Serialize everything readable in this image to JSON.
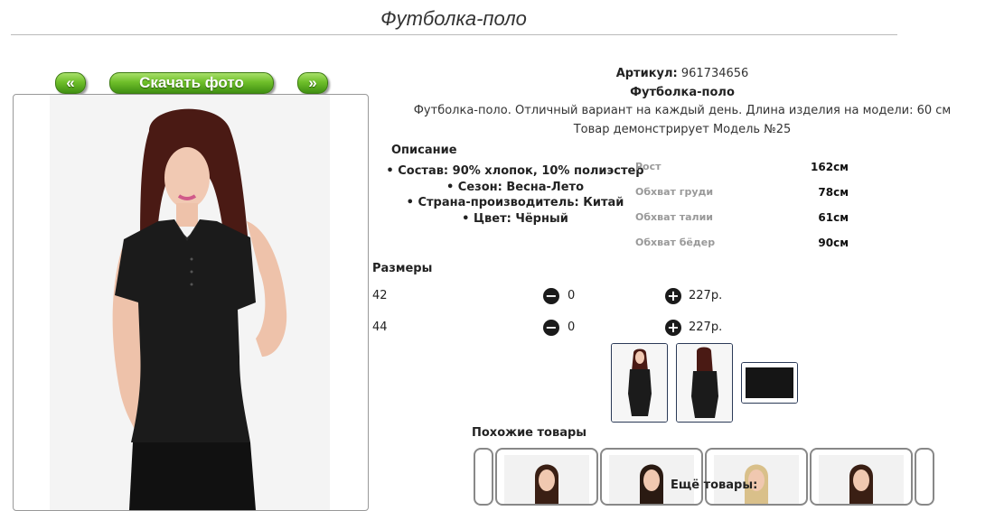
{
  "page": {
    "title": "Футболка-поло"
  },
  "gallery": {
    "prev_label": "«",
    "download_label": "Скачать фото",
    "next_label": "»"
  },
  "product": {
    "articul_label": "Артикул:",
    "articul_value": "961734656",
    "name": "Футболка-поло",
    "description": "Футболка-поло. Отличный вариант на каждый день. Длина изделия на модели: 60 см",
    "model_note": "Товар демонстрирует Модель №25"
  },
  "description": {
    "title": "Описание",
    "items": [
      "• Состав: 90% хлопок, 10% полиэстер",
      "• Сезон: Весна-Лето",
      "• Страна-производитель: Китай",
      "• Цвет: Чёрный"
    ]
  },
  "measurements": [
    {
      "label": "Рост",
      "value": "162см"
    },
    {
      "label": "Обхват груди",
      "value": "78см"
    },
    {
      "label": "Обхват талии",
      "value": "61см"
    },
    {
      "label": "Обхват бёдер",
      "value": "90см"
    }
  ],
  "sizes": {
    "title": "Размеры",
    "rows": [
      {
        "size": "42",
        "minus": "−",
        "qty": "0",
        "plus": "+",
        "price": "227р."
      },
      {
        "size": "44",
        "minus": "−",
        "qty": "0",
        "plus": "+",
        "price": "227р."
      }
    ]
  },
  "similar": {
    "title": "Похожие товары",
    "more": "Ещё товары:"
  },
  "colors": {
    "accent_green": "#6fbf2a",
    "thumb_border": "#2b3a57"
  }
}
